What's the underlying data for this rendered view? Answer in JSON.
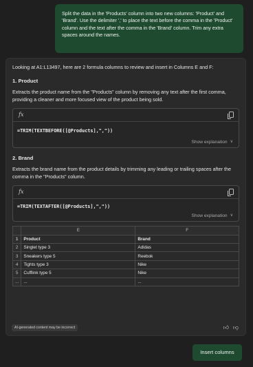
{
  "user_message": "Split the data in the 'Products' column into two new columns: 'Product' and 'Brand'. Use the delimiter ',' to place the text before the comma in the 'Product' column and the text after the comma in the 'Brand' column. Trim any extra spaces around the names.",
  "assistant": {
    "intro": "Looking at A1:L13497, here are 2 formula columns to review and insert in Columns E and F:",
    "sections": [
      {
        "title": "1. Product",
        "description": "Extracts the product name from the \"Products\" column by removing any text after the first comma, providing a cleaner and more focused view of the product being sold.",
        "formula": "=TRIM(TEXTBEFORE([@Products],\",\"))",
        "show_explanation": "Show explanation"
      },
      {
        "title": "2. Brand",
        "description": "Extracts the brand name from the product details by trimming any leading or trailing spaces after the comma in the \"Products\" column.",
        "formula": "=TRIM(TEXTAFTER([@Products],\",\"))",
        "show_explanation": "Show explanation"
      }
    ],
    "preview": {
      "columns": [
        "E",
        "F"
      ],
      "rows": [
        {
          "num": "1",
          "product": "Product",
          "brand": "Brand"
        },
        {
          "num": "2",
          "product": "Singlet type 3",
          "brand": "Adidas"
        },
        {
          "num": "3",
          "product": "Sneakers type 5",
          "brand": "Reebok"
        },
        {
          "num": "4",
          "product": "Tights type 3",
          "brand": "Nike"
        },
        {
          "num": "5",
          "product": "Cufflink type 5",
          "brand": "Nike"
        },
        {
          "num": "...",
          "product": "...",
          "brand": "..."
        }
      ]
    },
    "disclaimer": "AI-generated content may be incorrect",
    "fx_symbol": "fx",
    "icons": [
      "fx-icon",
      "copy-icon",
      "chevron-down-icon",
      "thumbs-up-icon",
      "thumbs-down-icon"
    ]
  },
  "insert_button": "Insert columns"
}
